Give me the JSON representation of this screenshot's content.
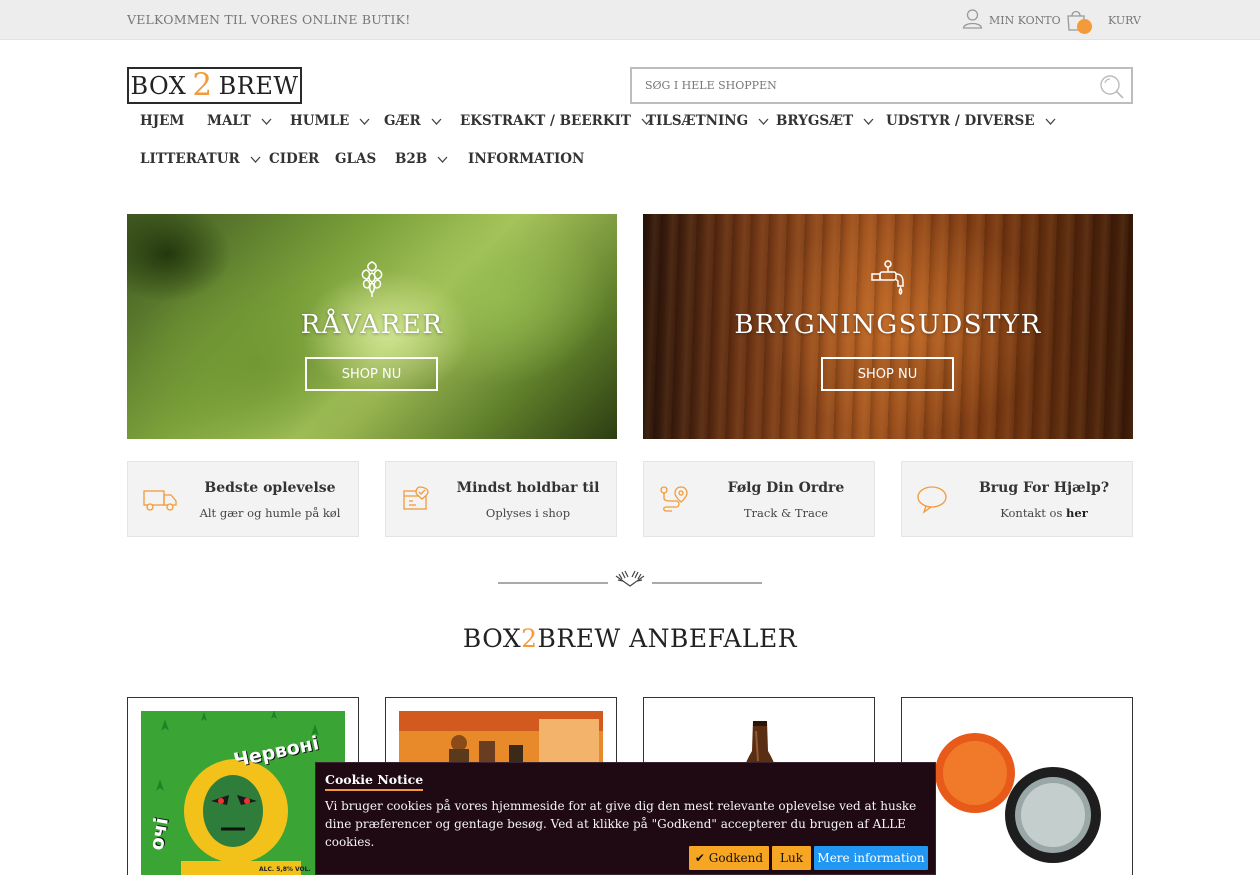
{
  "topbar": {
    "welcome": "VELKOMMEN TIL VORES ONLINE BUTIK!",
    "account_label": "MIN KONTO",
    "cart_label": "KURV"
  },
  "logo": {
    "part1": "BOX",
    "part2": "2",
    "part3": "BREW"
  },
  "search": {
    "placeholder": "SØG I HELE SHOPPEN"
  },
  "nav": [
    {
      "label": "HJEM"
    },
    {
      "label": "MALT"
    },
    {
      "label": "HUMLE"
    },
    {
      "label": "GÆR"
    },
    {
      "label": "EKSTRAKT / BEERKIT"
    },
    {
      "label": "TILSÆTNING"
    },
    {
      "label": "BRYGSÆT"
    },
    {
      "label": "UDSTYR / DIVERSE"
    },
    {
      "label": "LITTERATUR"
    },
    {
      "label": "CIDER"
    },
    {
      "label": "GLAS"
    },
    {
      "label": "B2B"
    },
    {
      "label": "INFORMATION"
    }
  ],
  "banners": [
    {
      "title": "RÅVARER",
      "button": "SHOP NU",
      "icon": "hops-icon"
    },
    {
      "title": "BRYGNINGSUDSTYR",
      "button": "SHOP NU",
      "icon": "tap-icon"
    }
  ],
  "features": [
    {
      "title": "Bedste oplevelse",
      "subtitle": "Alt gær og humle på køl",
      "icon": "truck-icon"
    },
    {
      "title": "Mindst holdbar til",
      "subtitle": "Oplyses i shop",
      "icon": "calendar-check-icon"
    },
    {
      "title": "Følg Din Ordre",
      "subtitle": "Track & Trace",
      "icon": "route-pin-icon"
    },
    {
      "title": "Brug For Hjælp?",
      "subtitle_prefix": "Kontakt os ",
      "subtitle_link": "her",
      "icon": "speech-bubble-icon"
    }
  ],
  "section": {
    "title_prefix": "BOX",
    "title_two": "2",
    "title_suffix": "BREW ANBEFALER"
  },
  "product_label": {
    "line1": "Червоні",
    "line2": "очі",
    "alc": "ALC. 5,8% VOL."
  },
  "cookie": {
    "title": "Cookie Notice",
    "text": "Vi bruger cookies på vores hjemmeside for at give dig den mest relevante oplevelse ved at huske dine præferencer og gentage besøg. Ved at klikke på \"Godkend\" accepterer du brugen af ALLE cookies.",
    "accept": "✔ Godkend",
    "close": "Luk",
    "more": "Mere information"
  },
  "colors": {
    "accent": "#f39a3a",
    "cookie_bg": "#1f0a14",
    "info_button": "#2196f3"
  }
}
